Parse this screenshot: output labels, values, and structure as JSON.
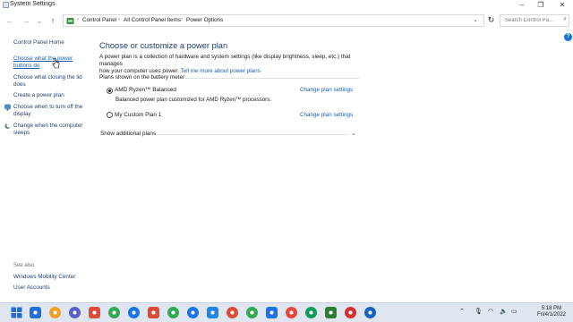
{
  "window": {
    "title": "System Settings"
  },
  "nav": {
    "breadcrumbs": [
      "Control Panel",
      "All Control Panel Items",
      "Power Options"
    ],
    "search_placeholder": "Search Control Pa..."
  },
  "left_pane": {
    "home": "Control Panel Home",
    "links": [
      {
        "label_line1": "Choose what the power",
        "label_line2": "buttons do"
      },
      {
        "label_line1": "Choose what closing the lid",
        "label_line2": "does"
      },
      {
        "label_line1": "Create a power plan"
      },
      {
        "label_line1": "Choose when to turn off the",
        "label_line2": "display"
      },
      {
        "label_line1": "Change when the computer",
        "label_line2": "sleeps"
      }
    ],
    "see_also": {
      "heading": "See also",
      "links": [
        "Windows Mobility Center",
        "User Accounts"
      ]
    }
  },
  "main": {
    "title": "Choose or customize a power plan",
    "description_line1": "A power plan is a collection of hardware and system settings (like display brightness, sleep, etc.) that manages",
    "description_line2": "how your computer uses power.",
    "more_link": "Tell me more about power plans",
    "section_heading": "Plans shown on the battery meter",
    "plans": [
      {
        "name": "AMD Ryzen™ Balanced",
        "description": "Balanced power plan customized for AMD Ryzen™ processors.",
        "selected": true,
        "link": "Change plan settings"
      },
      {
        "name": "My Custom Plan 1",
        "description": "",
        "selected": false,
        "link": "Change plan settings"
      }
    ],
    "additional_plans": "Show additional plans"
  },
  "taskbar": {
    "time": "5:18 PM",
    "date": "Fri/4/1/2022",
    "icon_colors": [
      "#1f6fd6",
      "#f0a020",
      "#5b5fc7",
      "#dd4b39",
      "#34a853",
      "#1a73e8",
      "#dd4b39",
      "#34a853",
      "#1a73e8",
      "#1e88e5",
      "#dd4b39",
      "#34a853",
      "#1a73e8",
      "#e8453c",
      "#0f9d58",
      "#2f7d32",
      "#d32f2f",
      "#1565c0"
    ]
  }
}
